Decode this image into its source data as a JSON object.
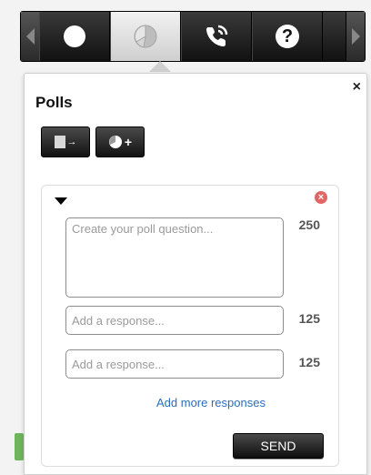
{
  "toolbar": {
    "items": [
      {
        "icon": "record-circle-icon",
        "active": false
      },
      {
        "icon": "poll-pie-icon",
        "active": true
      },
      {
        "icon": "phone-call-icon",
        "active": false
      },
      {
        "icon": "help-icon",
        "label": "?",
        "active": false
      }
    ]
  },
  "panel": {
    "title": "Polls",
    "close_label": "×",
    "export_button": {
      "icon": "export-icon"
    },
    "new_poll_button": {
      "icon": "new-poll-icon",
      "label": "+"
    }
  },
  "poll_form": {
    "question_placeholder": "Create your poll question...",
    "question_limit": "250",
    "responses": [
      {
        "placeholder": "Add a response...",
        "limit": "125"
      },
      {
        "placeholder": "Add a response...",
        "limit": "125"
      }
    ],
    "add_more_label": "Add more responses",
    "send_label": "SEND",
    "remove_label": "×"
  },
  "colors": {
    "accent_link": "#2a6ebb",
    "remove_red": "#e06666",
    "toolbar_dark": "#111111",
    "active_tab": "#cfcfcf"
  }
}
